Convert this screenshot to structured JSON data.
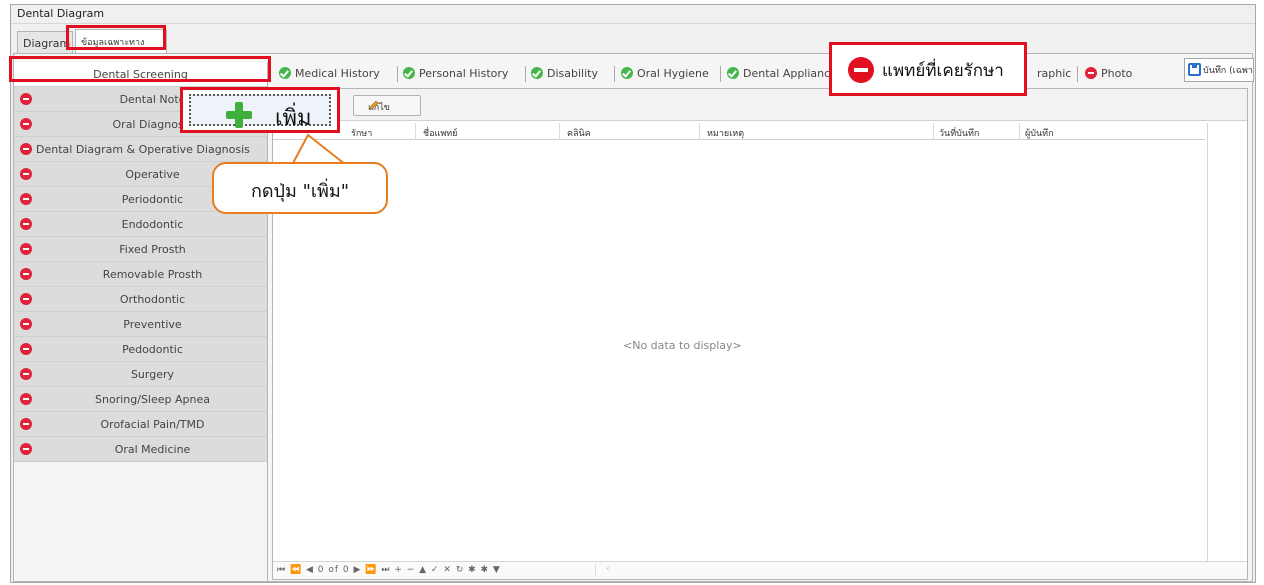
{
  "window": {
    "title": "Dental Diagram"
  },
  "top_tabs": [
    {
      "label": "Diagram"
    },
    {
      "label": "ข้อมูลเฉพาะทาง"
    }
  ],
  "sidebar": {
    "items": [
      {
        "label": "Dental Screening"
      },
      {
        "label": "Dental Note"
      },
      {
        "label": "Oral Diagnosis"
      },
      {
        "label": "Dental Diagram & Operative Diagnosis"
      },
      {
        "label": "Operative"
      },
      {
        "label": "Periodontic"
      },
      {
        "label": "Endodontic"
      },
      {
        "label": "Fixed Prosth"
      },
      {
        "label": "Removable Prosth"
      },
      {
        "label": "Orthodontic"
      },
      {
        "label": "Preventive"
      },
      {
        "label": "Pedodontic"
      },
      {
        "label": "Surgery"
      },
      {
        "label": "Snoring/Sleep Apnea"
      },
      {
        "label": "Orofacial Pain/TMD"
      },
      {
        "label": "Oral Medicine"
      }
    ]
  },
  "tabs": [
    {
      "label": "Medical History",
      "status": "done"
    },
    {
      "label": "Personal History",
      "status": "done"
    },
    {
      "label": "Disability",
      "status": "done"
    },
    {
      "label": "Oral Hygiene",
      "status": "done"
    },
    {
      "label": "Dental Appliance",
      "status": "done"
    },
    {
      "label": "raphic",
      "status": "none"
    },
    {
      "label": "Photo",
      "status": "stop"
    }
  ],
  "save_tab": {
    "label": "บันทึก (เฉพาะทาง)"
  },
  "toolbar": {
    "add_label": "เพิ่ม",
    "edit_label": "แก้ไข"
  },
  "grid": {
    "columns": [
      "รักษา",
      "ชื่อแพทย์",
      "คลินิค",
      "หมายเหตุ",
      "วันที่บันทึก",
      "ผู้บันทึก"
    ],
    "empty_message": "<No data to display>",
    "navigator": "⏮ ⏪ ◀  0 of 0  ▶ ⏩ ⏭ + − ▲ ✓ ✕ ↻ ✱ ✱ ▼"
  },
  "annotations": {
    "bubble_text": "กดปุ่ม \"เพิ่ม\"",
    "callout_text": "แพทย์ที่เคยรักษา"
  },
  "colors": {
    "highlight": "#e01020",
    "ok": "#45b649",
    "stop": "#e0223a",
    "bubble_border": "#e87c1e"
  }
}
